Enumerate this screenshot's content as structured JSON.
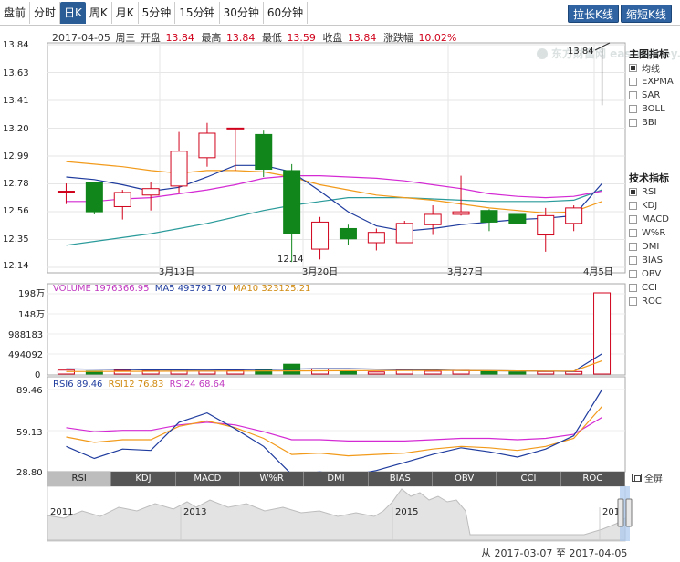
{
  "tabs": [
    {
      "label": "盘前",
      "active": false
    },
    {
      "label": "分时",
      "active": false
    },
    {
      "label": "日K",
      "active": true
    },
    {
      "label": "周K",
      "active": false
    },
    {
      "label": "月K",
      "active": false
    },
    {
      "label": "5分钟",
      "active": false
    },
    {
      "label": "15分钟",
      "active": false
    },
    {
      "label": "30分钟",
      "active": false
    },
    {
      "label": "60分钟",
      "active": false
    }
  ],
  "buttons": {
    "stretch": "拉长K线",
    "shrink": "缩短K线"
  },
  "info": {
    "date": "2017-04-05",
    "weekday": "周三",
    "open_label": "开盘",
    "open": "13.84",
    "high_label": "最高",
    "high": "13.84",
    "low_label": "最低",
    "low": "13.59",
    "close_label": "收盘",
    "close": "13.84",
    "change_label": "涨跌幅",
    "change": "10.02%"
  },
  "watermark": "东方财富网 eastmoney.com",
  "price_axis": {
    "ticks": [
      "13.84",
      "13.63",
      "13.41",
      "13.20",
      "12.99",
      "12.78",
      "12.56",
      "12.35",
      "12.14"
    ]
  },
  "date_axis": {
    "labels": [
      "3月13日",
      "3月20日",
      "3月27日",
      "4月5日"
    ]
  },
  "annotations": {
    "high_label": "13.84",
    "low_label": "12.14"
  },
  "volume_legend": {
    "volume": "VOLUME 1976366.95",
    "ma5": "MA5 493791.70",
    "ma10": "MA10 323125.21"
  },
  "volume_axis": {
    "ticks": [
      "198万",
      "148万",
      "988183",
      "494092",
      "0"
    ]
  },
  "rsi_legend": {
    "rsi6": "RSI6 89.46",
    "rsi12": "RSI12 76.83",
    "rsi24": "RSI24 68.64"
  },
  "rsi_axis": {
    "ticks": [
      "89.46",
      "59.13",
      "28.80"
    ]
  },
  "main_indicators": {
    "title": "主图指标",
    "items": [
      {
        "label": "均线",
        "checked": true
      },
      {
        "label": "EXPMA",
        "checked": false
      },
      {
        "label": "SAR",
        "checked": false
      },
      {
        "label": "BOLL",
        "checked": false
      },
      {
        "label": "BBI",
        "checked": false
      }
    ]
  },
  "tech_indicators": {
    "title": "技术指标",
    "items": [
      {
        "label": "RSI",
        "checked": true
      },
      {
        "label": "KDJ",
        "checked": false
      },
      {
        "label": "MACD",
        "checked": false
      },
      {
        "label": "W%R",
        "checked": false
      },
      {
        "label": "DMI",
        "checked": false
      },
      {
        "label": "BIAS",
        "checked": false
      },
      {
        "label": "OBV",
        "checked": false
      },
      {
        "label": "CCI",
        "checked": false
      },
      {
        "label": "ROC",
        "checked": false
      }
    ]
  },
  "indicator_tabs": [
    {
      "label": "RSI",
      "active": true
    },
    {
      "label": "KDJ",
      "active": false
    },
    {
      "label": "MACD",
      "active": false
    },
    {
      "label": "W%R",
      "active": false
    },
    {
      "label": "DMI",
      "active": false
    },
    {
      "label": "BIAS",
      "active": false
    },
    {
      "label": "OBV",
      "active": false
    },
    {
      "label": "CCI",
      "active": false
    },
    {
      "label": "ROC",
      "active": false
    }
  ],
  "fullscreen_label": "全屏",
  "navigator": {
    "years": [
      "2011",
      "2013",
      "2015",
      "201"
    ]
  },
  "range": {
    "from_label": "从",
    "from": "2017-03-07",
    "to_label": "至",
    "to": "2017-04-05"
  },
  "colors": {
    "up": "#d0021b",
    "down": "#11861b",
    "ma5": "#1f3c9e",
    "ma10": "#f29a1a",
    "ma20": "#d42ad4",
    "ma30": "#2a9a9a"
  },
  "chart_data": {
    "type": "candlestick",
    "ylim": [
      12.14,
      13.84
    ],
    "candles": [
      {
        "open": 12.71,
        "close": 12.71,
        "high": 12.77,
        "low": 12.61
      },
      {
        "open": 12.78,
        "close": 12.55,
        "high": 12.78,
        "low": 12.53
      },
      {
        "open": 12.59,
        "close": 12.7,
        "high": 12.72,
        "low": 12.49
      },
      {
        "open": 12.68,
        "close": 12.73,
        "high": 12.78,
        "low": 12.56
      },
      {
        "open": 12.75,
        "close": 13.02,
        "high": 13.17,
        "low": 12.7
      },
      {
        "open": 12.97,
        "close": 13.16,
        "high": 13.24,
        "low": 12.9
      },
      {
        "open": 13.2,
        "close": 13.2,
        "high": 13.2,
        "low": 12.87
      },
      {
        "open": 13.15,
        "close": 12.88,
        "high": 13.18,
        "low": 12.82
      },
      {
        "open": 12.87,
        "close": 12.38,
        "high": 12.92,
        "low": 12.16
      },
      {
        "open": 12.26,
        "close": 12.47,
        "high": 12.51,
        "low": 12.18
      },
      {
        "open": 12.42,
        "close": 12.34,
        "high": 12.45,
        "low": 12.29
      },
      {
        "open": 12.31,
        "close": 12.39,
        "high": 12.42,
        "low": 12.25
      },
      {
        "open": 12.31,
        "close": 12.46,
        "high": 12.48,
        "low": 12.31
      },
      {
        "open": 12.45,
        "close": 12.53,
        "high": 12.6,
        "low": 12.37
      },
      {
        "open": 12.53,
        "close": 12.55,
        "high": 12.83,
        "low": 12.52
      },
      {
        "open": 12.56,
        "close": 12.47,
        "high": 12.57,
        "low": 12.4
      },
      {
        "open": 12.53,
        "close": 12.46,
        "high": 12.53,
        "low": 12.46
      },
      {
        "open": 12.37,
        "close": 12.52,
        "high": 12.58,
        "low": 12.24
      },
      {
        "open": 12.46,
        "close": 12.58,
        "high": 12.6,
        "low": 12.4
      },
      {
        "open": 12.71,
        "close": 12.71,
        "high": 13.84,
        "low": 13.59
      }
    ],
    "ma5": [
      12.82,
      12.8,
      12.76,
      12.71,
      12.74,
      12.82,
      12.91,
      12.91,
      12.86,
      12.71,
      12.55,
      12.44,
      12.4,
      12.42,
      12.45,
      12.47,
      12.49,
      12.5,
      12.52,
      12.77
    ],
    "ma10": [
      12.94,
      12.92,
      12.9,
      12.87,
      12.85,
      12.87,
      12.87,
      12.86,
      12.82,
      12.76,
      12.72,
      12.68,
      12.66,
      12.64,
      12.61,
      12.58,
      12.56,
      12.54,
      12.55,
      12.63
    ],
    "ma20": [
      12.63,
      12.63,
      12.65,
      12.66,
      12.69,
      12.72,
      12.76,
      12.81,
      12.83,
      12.83,
      12.82,
      12.81,
      12.79,
      12.76,
      12.73,
      12.69,
      12.67,
      12.66,
      12.67,
      12.71
    ],
    "ma30": [
      12.29,
      12.32,
      12.35,
      12.38,
      12.42,
      12.46,
      12.51,
      12.56,
      12.6,
      12.63,
      12.66,
      12.66,
      12.66,
      12.65,
      12.64,
      12.63,
      12.63,
      12.63,
      12.64,
      12.72
    ],
    "volume": [
      95000,
      70000,
      90000,
      80000,
      120000,
      70000,
      85000,
      90000,
      240000,
      130000,
      60000,
      50000,
      90000,
      70000,
      90000,
      60000,
      50000,
      60000,
      60000,
      1976366.95
    ],
    "volume_ma5": [
      125000,
      118000,
      110000,
      100000,
      98000,
      96000,
      102000,
      110000,
      120000,
      130000,
      130000,
      120000,
      110000,
      100000,
      85000,
      80000,
      75000,
      70000,
      65000,
      493791.7
    ],
    "volume_ma10": [
      60000,
      62000,
      64000,
      66000,
      68000,
      70000,
      72000,
      74000,
      76000,
      78000,
      80000,
      82000,
      84000,
      86000,
      84000,
      80000,
      75000,
      70000,
      70000,
      323125.21
    ],
    "volume_ylim": [
      0,
      1976366.95
    ],
    "rsi6": [
      47,
      38,
      45,
      44,
      65,
      72,
      60,
      47,
      26,
      28,
      25,
      29,
      35,
      41,
      46,
      43,
      39,
      45,
      55,
      89.46
    ],
    "rsi12": [
      54,
      50,
      52,
      52,
      62,
      66,
      61,
      53,
      41,
      42,
      40,
      41,
      42,
      45,
      47,
      46,
      44,
      47,
      53,
      76.83
    ],
    "rsi24": [
      61,
      58,
      59,
      59,
      63,
      65,
      63,
      58,
      52,
      52,
      51,
      51,
      51,
      52,
      53,
      53,
      52,
      53,
      56,
      68.64
    ],
    "rsi_ylim": [
      28.8,
      89.46
    ]
  }
}
